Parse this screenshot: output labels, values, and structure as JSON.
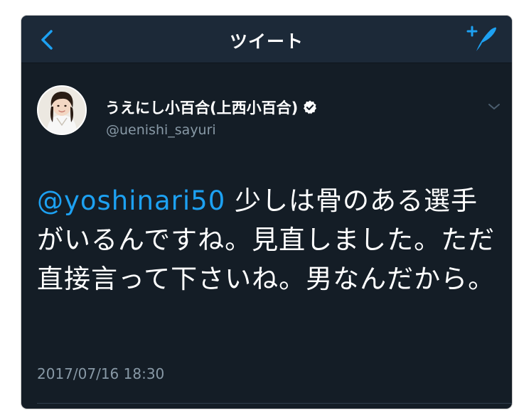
{
  "navbar": {
    "title": "ツイート",
    "back_icon": "chevron-left-icon",
    "compose_icon": "compose-tweet-icon"
  },
  "tweet": {
    "display_name": "うえにし小百合(上西小百合)",
    "handle": "@uenishi_sayuri",
    "verified": true,
    "mention": "@yoshinari50",
    "body": " 少しは骨のある選手がいるんですね。見直しました。ただ直接言って下さいね。男なんだから。",
    "timestamp": "2017/07/16 18:30"
  },
  "colors": {
    "background": "#141d26",
    "navbar": "#1c2938",
    "accent": "#1da1f2",
    "secondary_text": "#8899a6",
    "primary_text": "#ffffff"
  }
}
